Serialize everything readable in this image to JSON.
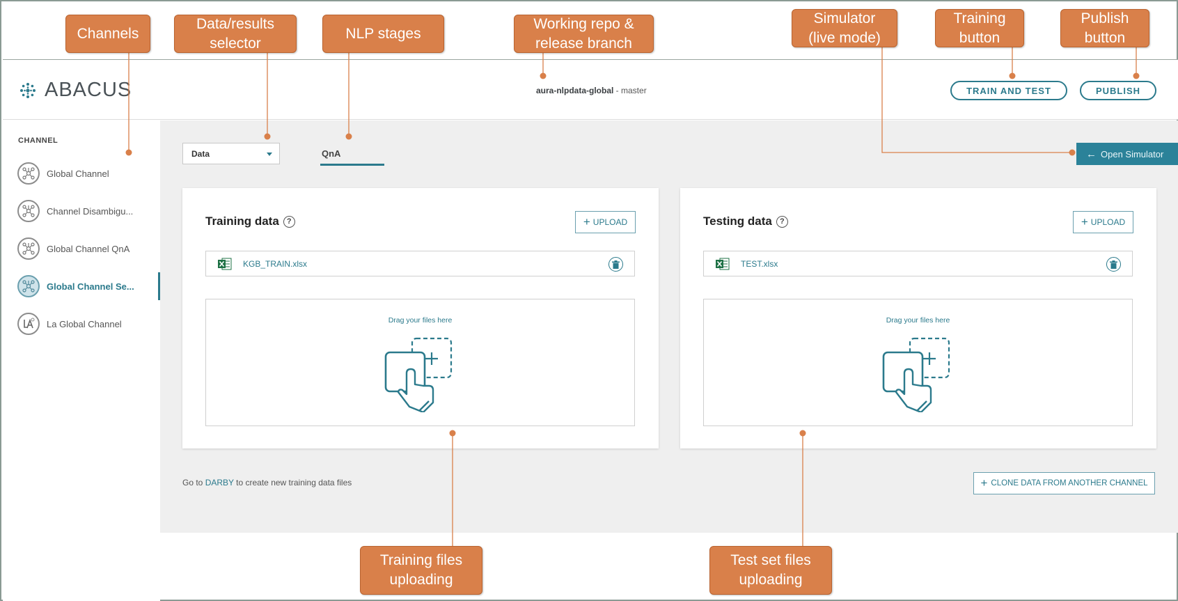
{
  "app": {
    "name": "ABACUS"
  },
  "header": {
    "repo_name": "aura-nlpdata-global",
    "repo_separator": " - ",
    "branch": "master",
    "train_label": "TRAIN AND TEST",
    "publish_label": "PUBLISH"
  },
  "sidebar": {
    "heading": "CHANNEL",
    "items": [
      {
        "label": "Global Channel",
        "icon": "network-icon",
        "active": false
      },
      {
        "label": "Channel Disambigu...",
        "icon": "network-icon",
        "active": false
      },
      {
        "label": "Global Channel QnA",
        "icon": "network-icon",
        "active": false
      },
      {
        "label": "Global Channel Se...",
        "icon": "network-icon",
        "active": true
      },
      {
        "label": "La Global Channel",
        "icon": "la-logo-icon",
        "active": false
      }
    ]
  },
  "toolbar": {
    "selector_value": "Data",
    "stage_tab": "QnA",
    "simulator_label": "Open Simulator"
  },
  "training": {
    "title": "Training data",
    "help": "?",
    "upload_label": "UPLOAD",
    "file_name": "KGB_TRAIN.xlsx",
    "drop_text": "Drag your files here"
  },
  "testing": {
    "title": "Testing data",
    "help": "?",
    "upload_label": "UPLOAD",
    "file_name": "TEST.xlsx",
    "drop_text": "Drag your files here"
  },
  "footer": {
    "prefix": "Go to ",
    "link": "DARBY",
    "suffix": " to create new training data files",
    "clone_label": "CLONE DATA FROM ANOTHER CHANNEL"
  },
  "annotations": {
    "channels": "Channels",
    "selector": "Data/results\nselector",
    "nlp_stages": "NLP stages",
    "repo": "Working repo &\nrelease branch",
    "simulator": "Simulator\n(live mode)",
    "training_button": "Training\nbutton",
    "publish_button": "Publish\nbutton",
    "training_upload": "Training files\nuploading",
    "test_upload": "Test set files\nuploading"
  },
  "colors": {
    "accent": "#2b7a8c",
    "annotation": "#d9804a",
    "excel": "#1e7145"
  }
}
